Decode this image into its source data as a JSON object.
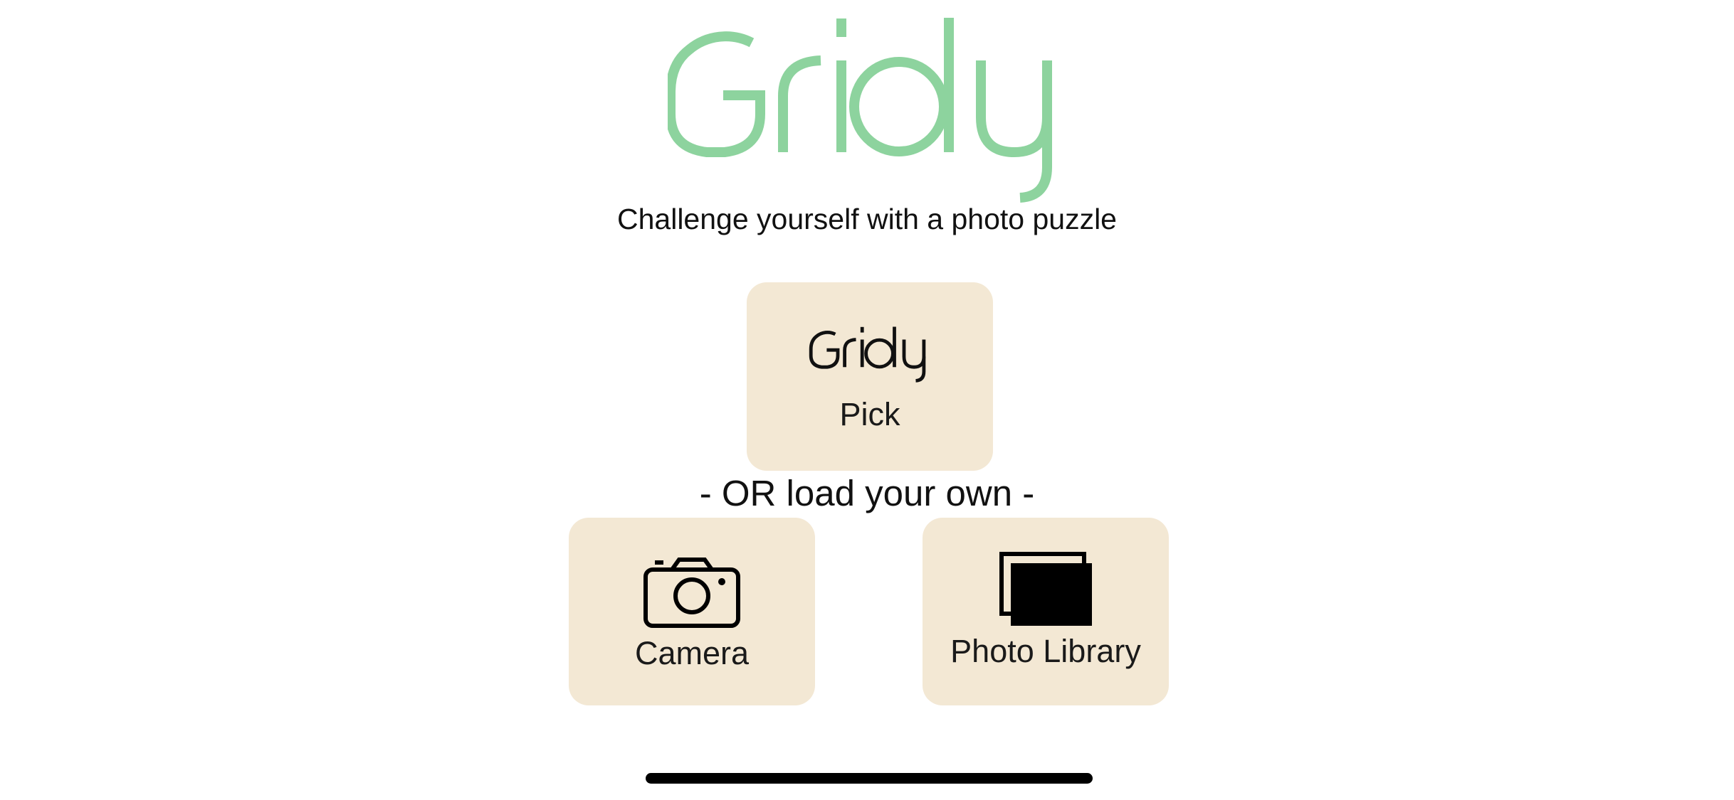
{
  "app": {
    "title": "Gridy",
    "subtitle": "Challenge yourself with a photo puzzle",
    "brand_color": "#8dd39e",
    "tile_color": "#f3e8d4"
  },
  "pick": {
    "logo_text": "Gridy",
    "label": "Pick"
  },
  "divider": {
    "text": "- OR load your own -"
  },
  "sources": [
    {
      "label": "Camera",
      "icon": "camera-icon"
    },
    {
      "label": "Photo Library",
      "icon": "photo-library-icon"
    }
  ]
}
